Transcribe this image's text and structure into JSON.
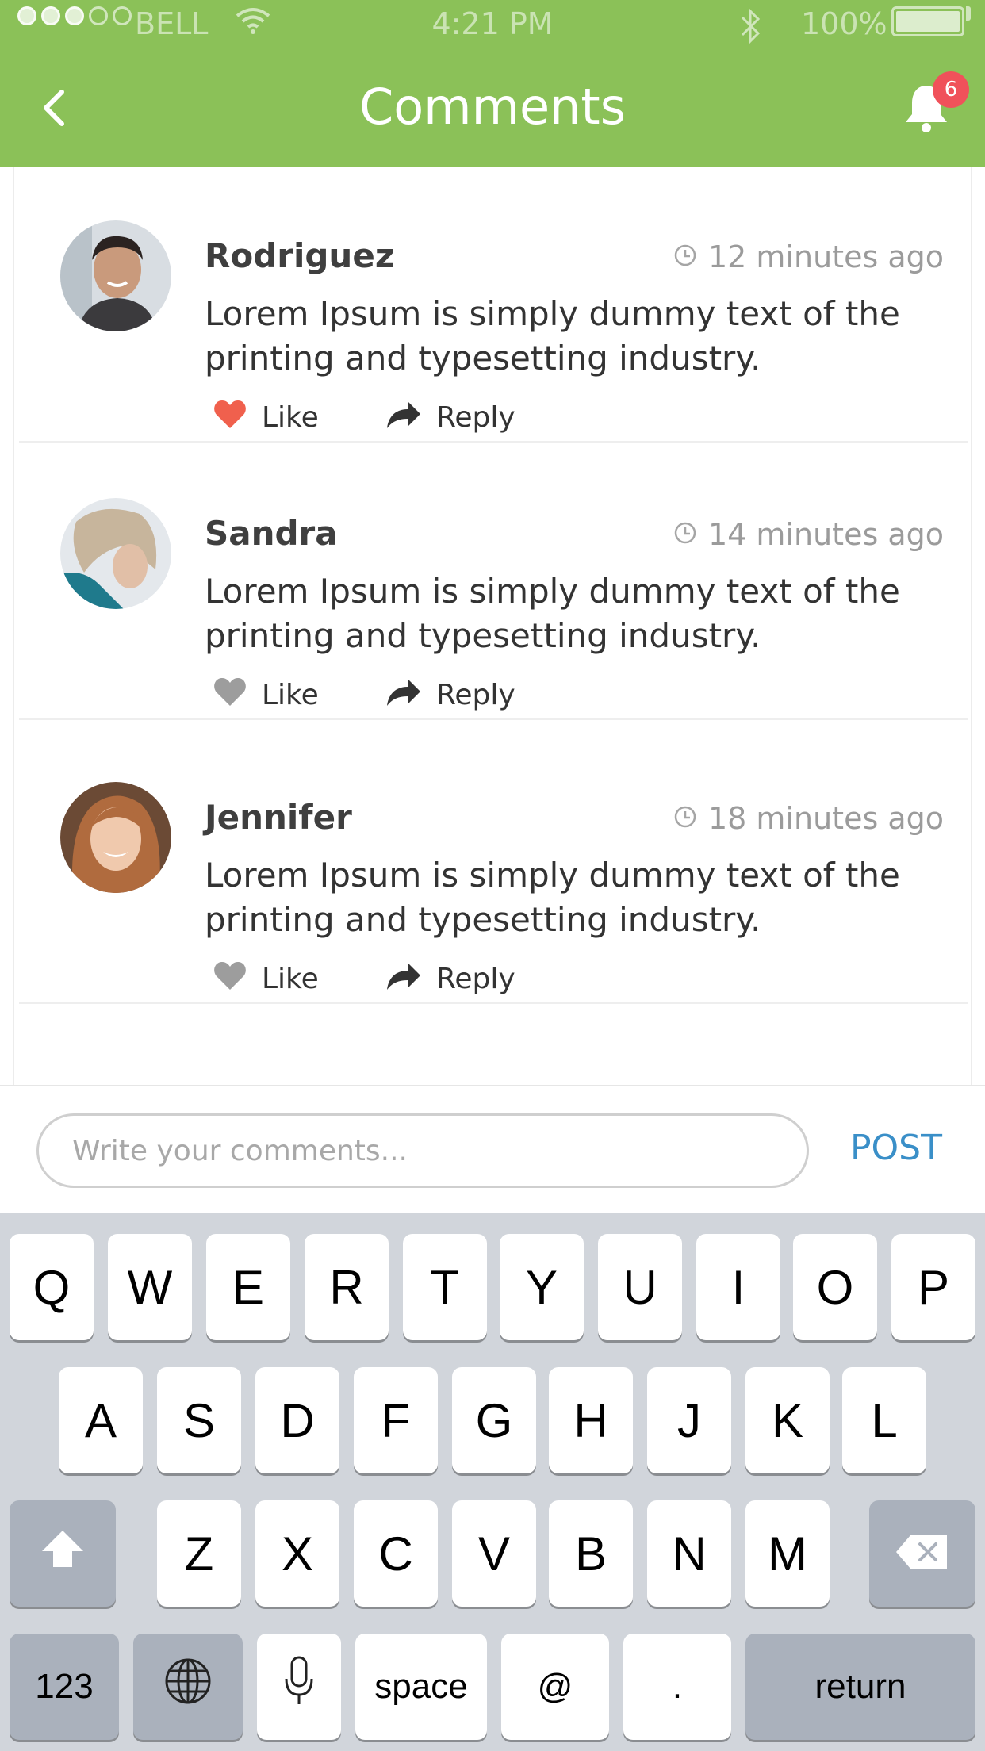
{
  "status_bar": {
    "carrier": "BELL",
    "time": "4:21 PM",
    "battery": "100%"
  },
  "header": {
    "title": "Comments",
    "notification_count": "6"
  },
  "comments": [
    {
      "name": "Rodriguez",
      "time": "12 minutes ago",
      "text": "Lorem Ipsum is simply dummy text of the printing and typesetting industry.",
      "like_label": "Like",
      "reply_label": "Reply",
      "liked": true
    },
    {
      "name": "Sandra",
      "time": "14 minutes ago",
      "text": "Lorem Ipsum is simply dummy text of the printing and typesetting industry.",
      "like_label": "Like",
      "reply_label": "Reply",
      "liked": false
    },
    {
      "name": "Jennifer",
      "time": "18 minutes ago",
      "text": "Lorem Ipsum is simply dummy text of the printing and typesetting industry.",
      "like_label": "Like",
      "reply_label": "Reply",
      "liked": false
    }
  ],
  "input": {
    "placeholder": "Write your comments...",
    "post_label": "POST"
  },
  "keyboard": {
    "row1": [
      "Q",
      "W",
      "E",
      "R",
      "T",
      "Y",
      "U",
      "I",
      "O",
      "P"
    ],
    "row2": [
      "A",
      "S",
      "D",
      "F",
      "G",
      "H",
      "J",
      "K",
      "L"
    ],
    "row3": [
      "Z",
      "X",
      "C",
      "V",
      "B",
      "N",
      "M"
    ],
    "numbers_label": "123",
    "space_label": "space",
    "at_label": "@",
    "period_label": ".",
    "return_label": "return"
  },
  "colors": {
    "header_green": "#8bc158",
    "liked_heart": "#f0604d",
    "unliked_heart": "#9d9d9d",
    "post_blue": "#3a8fc8",
    "badge_red": "#f0515a"
  },
  "icons": {
    "back": "chevron-left-icon",
    "bell": "bell-icon",
    "clock": "clock-icon",
    "heart": "heart-icon",
    "reply": "reply-arrow-icon",
    "shift": "shift-icon",
    "delete": "backspace-icon",
    "globe": "globe-icon",
    "mic": "microphone-icon"
  }
}
